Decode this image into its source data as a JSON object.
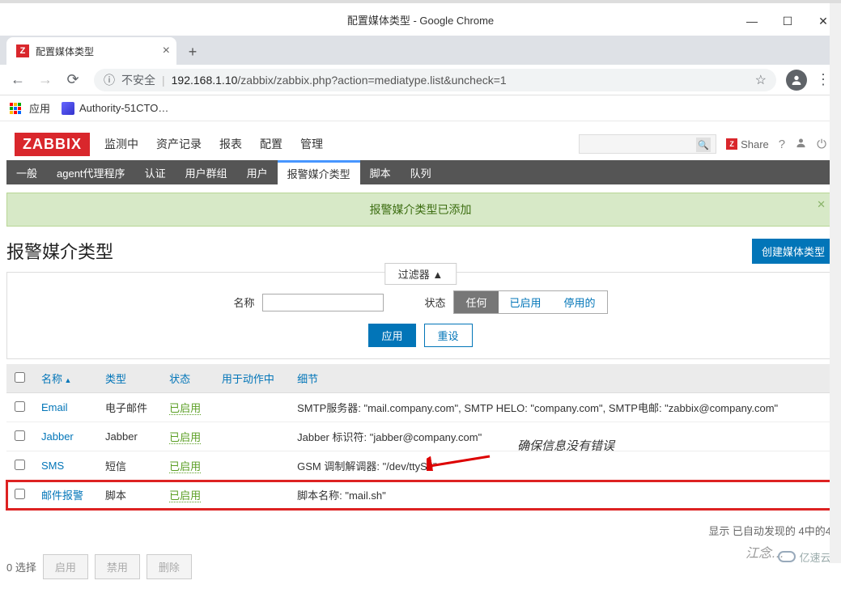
{
  "window": {
    "title": "配置媒体类型 - Google Chrome",
    "minimize": "—",
    "maximize": "☐",
    "close": "✕"
  },
  "tab": {
    "title": "配置媒体类型",
    "favicon": "Z"
  },
  "addressbar": {
    "info": "ⓘ",
    "unsafe": "不安全",
    "host": "192.168.1.10",
    "path": "/zabbix/zabbix.php?action=mediatype.list&uncheck=1"
  },
  "bookmarks": {
    "apps": "应用",
    "item1": "Authority-51CTO…"
  },
  "zabbix": {
    "logo": "ZABBIX",
    "topnav": [
      "监测中",
      "资产记录",
      "报表",
      "配置",
      "管理"
    ],
    "topnav_active": 4,
    "share": "Share",
    "subnav": [
      "一般",
      "agent代理程序",
      "认证",
      "用户群组",
      "用户",
      "报警媒介类型",
      "脚本",
      "队列"
    ],
    "subnav_active": 5
  },
  "message": {
    "text": "报警媒介类型已添加"
  },
  "page": {
    "title": "报警媒介类型",
    "create_btn": "创建媒体类型"
  },
  "filter": {
    "toggle": "过滤器  ▲",
    "name_label": "名称",
    "status_label": "状态",
    "seg": [
      "任何",
      "已启用",
      "停用的"
    ],
    "seg_active": 0,
    "apply": "应用",
    "reset": "重设"
  },
  "table": {
    "headers": {
      "name": "名称",
      "type": "类型",
      "status": "状态",
      "used_in": "用于动作中",
      "details": "细节"
    },
    "rows": [
      {
        "name": "Email",
        "type": "电子邮件",
        "status": "已启用",
        "details": "SMTP服务器: \"mail.company.com\", SMTP HELO: \"company.com\", SMTP电邮: \"zabbix@company.com\""
      },
      {
        "name": "Jabber",
        "type": "Jabber",
        "status": "已启用",
        "details": "Jabber 标识符: \"jabber@company.com\""
      },
      {
        "name": "SMS",
        "type": "短信",
        "status": "已启用",
        "details": "GSM 调制解调器: \"/dev/ttyS0\""
      },
      {
        "name": "邮件报警",
        "type": "脚本",
        "status": "已启用",
        "details": "脚本名称: \"mail.sh\""
      }
    ],
    "footer": "显示 已自动发现的 4中的4"
  },
  "bulk": {
    "selected": "0 选择",
    "enable": "启用",
    "disable": "禁用",
    "delete": "删除"
  },
  "annotation": "确保信息没有错误",
  "watermark": "江念…",
  "yisu": "亿速云"
}
